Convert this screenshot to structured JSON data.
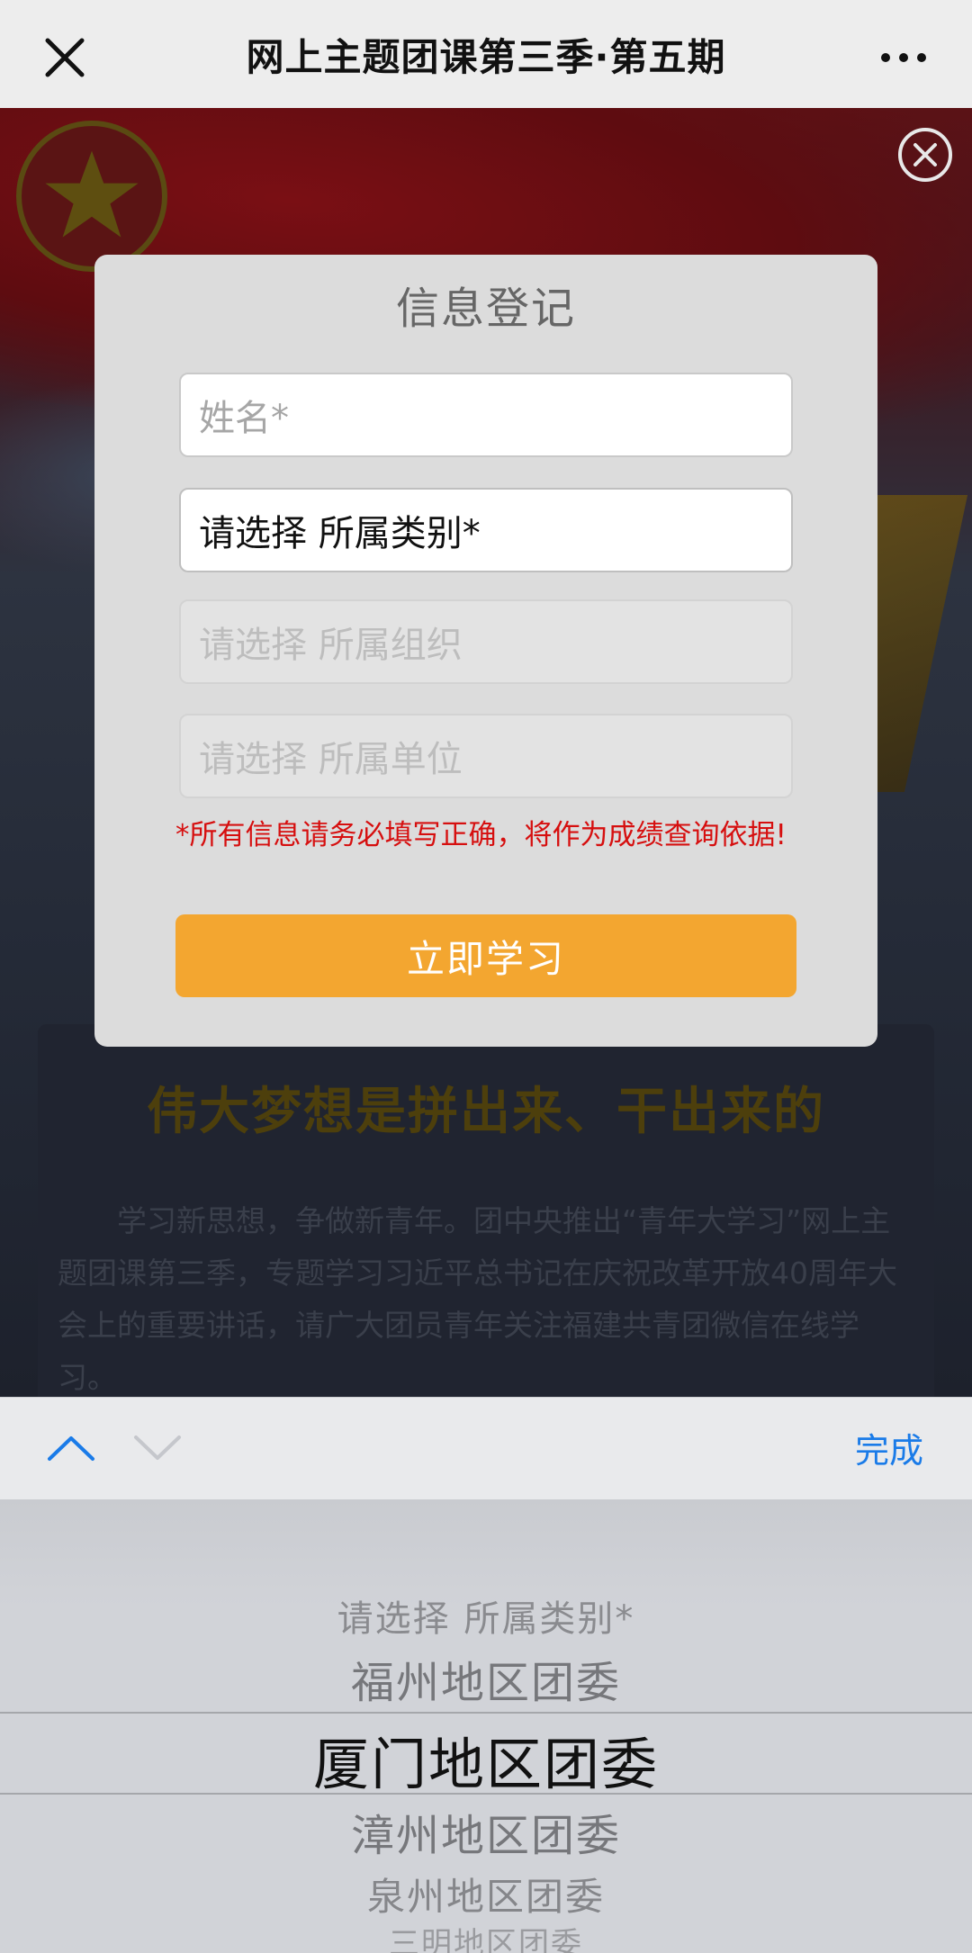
{
  "navbar": {
    "title": "网上主题团课第三季·第五期",
    "close_icon": "close-icon",
    "more_icon": "more-icon"
  },
  "background": {
    "card_title": "伟大梦想是拼出来、干出来的",
    "card_text": "学习新思想，争做新青年。团中央推出“青年大学习”网上主题团课第三季，专题学习习近平总书记在庆祝改革开放40周年大会上的重要讲话，请广大团员青年关注福建共青团微信在线学习。"
  },
  "modal": {
    "title": "信息登记",
    "name_placeholder": "姓名*",
    "category_value": "请选择 所属类别*",
    "org_placeholder": "请选择 所属组织",
    "unit_placeholder": "请选择 所属单位",
    "notice": "*所有信息请务必填写正确，将作为成绩查询依据!",
    "study_button": "立即学习"
  },
  "picker": {
    "done_label": "完成",
    "options": [
      "请选择 所属类别*",
      "福州地区团委",
      "厦门地区团委",
      "漳州地区团委",
      "泉州地区团委",
      "三明地区团委"
    ],
    "selected_index": 2
  },
  "colors": {
    "accent_orange": "#f3a630",
    "notice_red": "#d60f0f",
    "link_blue": "#1a7be8"
  }
}
